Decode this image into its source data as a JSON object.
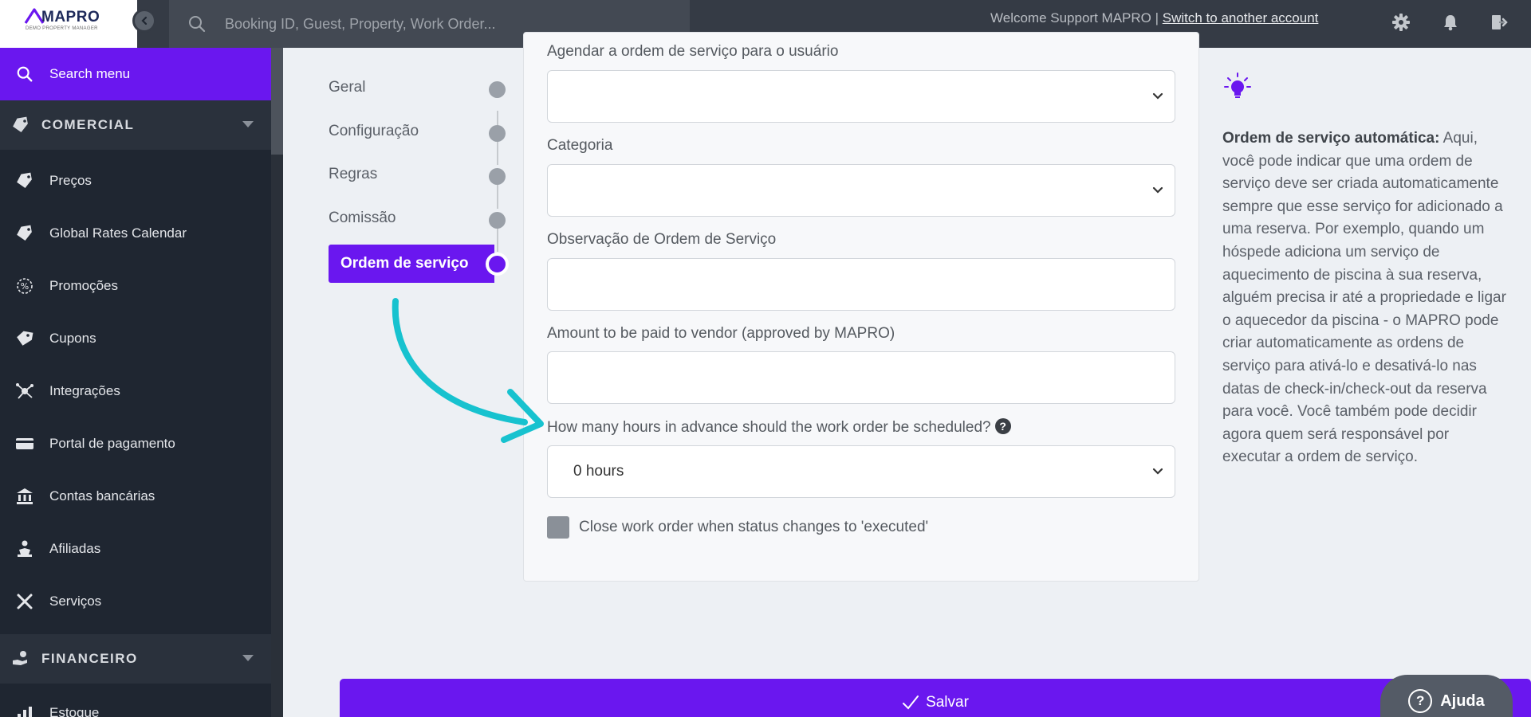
{
  "logo": {
    "brand": "MAPRO",
    "tagline": "DEMO PROPERTY MANAGER"
  },
  "search": {
    "placeholder": "Booking ID, Guest, Property, Work Order..."
  },
  "header": {
    "welcome": "Welcome Support MAPRO |",
    "switch_link": "Switch to another account"
  },
  "sidebar": {
    "search_menu": "Search menu",
    "sections": [
      {
        "label": "COMERCIAL"
      },
      {
        "label": "FINANCEIRO"
      }
    ],
    "items": [
      {
        "label": "Preços",
        "icon": "price-tag-icon"
      },
      {
        "label": "Global Rates Calendar",
        "icon": "price-tag-icon"
      },
      {
        "label": "Promoções",
        "icon": "percent-icon"
      },
      {
        "label": "Cupons",
        "icon": "coupon-icon"
      },
      {
        "label": "Integrações",
        "icon": "integrations-icon"
      },
      {
        "label": "Portal de pagamento",
        "icon": "credit-card-icon"
      },
      {
        "label": "Contas bancárias",
        "icon": "bank-icon"
      },
      {
        "label": "Afiliadas",
        "icon": "affiliate-icon"
      },
      {
        "label": "Serviços",
        "icon": "tools-icon"
      },
      {
        "label": "Estoque",
        "icon": "inventory-icon"
      }
    ]
  },
  "steps": [
    {
      "label": "Geral"
    },
    {
      "label": "Configuração"
    },
    {
      "label": "Regras"
    },
    {
      "label": "Comissão"
    },
    {
      "label": "Ordem de serviço",
      "active": true
    }
  ],
  "form": {
    "schedule_label": "Agendar a ordem de serviço para o usuário",
    "category_label": "Categoria",
    "observation_label": "Observação de Ordem de Serviço",
    "amount_label": "Amount to be paid to vendor (approved by MAPRO)",
    "hours_label": "How many hours in advance should the work order be scheduled?",
    "hours_value": "0 hours",
    "close_label": "Close work order when status changes to 'executed'"
  },
  "tip": {
    "title": "Ordem de serviço automática:",
    "body": "Aqui, você pode indicar que uma ordem de serviço deve ser criada automaticamente sempre que esse serviço for adicionado a uma reserva. Por exemplo, quando um hóspede adiciona um serviço de aquecimento de piscina à sua reserva, alguém precisa ir até a propriedade e ligar o aquecedor da piscina - o MAPRO pode criar automaticamente as ordens de serviço para ativá-lo e desativá-lo nas datas de check-in/check-out da reserva para você. Você também pode decidir agora quem será responsável por executar a ordem de serviço."
  },
  "save_label": "Salvar",
  "help_label": "Ajuda",
  "colors": {
    "accent": "#6a17ef",
    "annotation_arrow": "#17c2cf",
    "topbar": "#353b45",
    "sidebar": "#1f2631"
  }
}
